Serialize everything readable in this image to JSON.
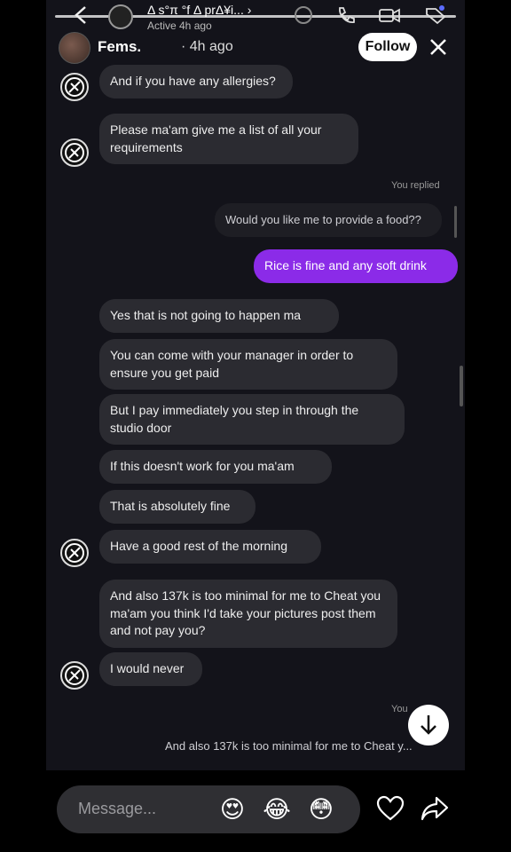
{
  "chat_header": {
    "name": "Δ s°π °f Δ prΔ¥i... ›",
    "status": "Active 4h ago"
  },
  "story_header": {
    "username": "Fems.",
    "time": "· 4h ago",
    "follow_label": "Follow"
  },
  "messages": [
    {
      "text": "And if you have any allergies?"
    },
    {
      "text": "Please ma'am give me a list of all your requirements"
    },
    {
      "text": "Would you like me to provide a food??"
    },
    {
      "text": "Rice is fine and any soft drink"
    },
    {
      "text": "Yes that is not going to  happen ma"
    },
    {
      "text": "You can come with your manager in order to ensure you get paid"
    },
    {
      "text": "But I pay immediately you step in through the studio door"
    },
    {
      "text": "If this doesn't work for you ma'am"
    },
    {
      "text": "That is absolutely fine"
    },
    {
      "text": "Have a good rest of the morning"
    },
    {
      "text": "And also 137k is too minimal for me to Cheat you ma'am you think I'd take your pictures post them and not pay you?"
    },
    {
      "text": "I would never"
    },
    {
      "text": "And also 137k is too minimal for me to Cheat y..."
    }
  ],
  "labels": {
    "you_replied": "You replied",
    "you": "You"
  },
  "composer": {
    "placeholder": "Message...",
    "emojis": [
      "😍",
      "😂",
      "😳"
    ]
  },
  "colors": {
    "accent": "#8b2be8",
    "background": "#13131a",
    "bubble": "#2b2b31"
  }
}
